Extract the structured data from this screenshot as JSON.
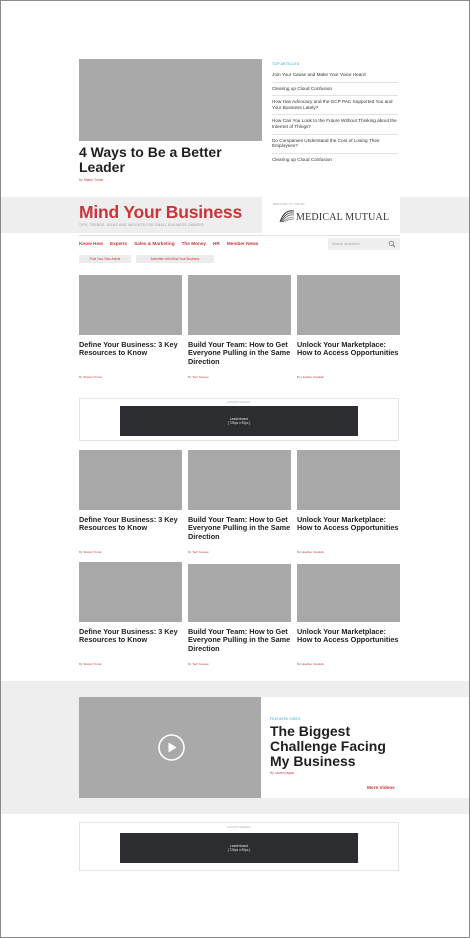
{
  "hero": {
    "title": "4 Ways to Be a Better Leader",
    "byline_prefix": "By",
    "author": "Shawn Turner"
  },
  "top_articles": {
    "label": "TOP ARTICLES",
    "items": [
      "Join Your Cause and Make Your Voice Heard",
      "Clearing up Cloud Confusion",
      "How Has Advocacy and the GCP PAC Supported You and Your Business Lately?",
      "How Can You Look to the Future Without Thinking about the Internet of Things?",
      "Do Companies Understand the Cost of Losing Their Employees?",
      "Clearing up Cloud Confusion"
    ]
  },
  "brand": {
    "title": "Mind Your Business",
    "tagline": "TIPS, TRENDS, IDEAS AND INSIGHTS FOR SMALL BUSINESS OWNERS",
    "sponsor_label": "BROUGHT TO YOU BY",
    "sponsor_name": "MEDICAL MUTUAL"
  },
  "nav": {
    "items": [
      "Know How",
      "Experts",
      "Sales & Marketing",
      "The Money",
      "HR",
      "Member News"
    ],
    "search_placeholder": "Search all articles",
    "pills": [
      "Post Your Own Article",
      "Advertise with Mind Your Business"
    ]
  },
  "cards": [
    {
      "title": "Define Your Business: 3 Key Resources to Know",
      "author": "Shawn Turner"
    },
    {
      "title": "Build Your Team: How to Get Everyone Pulling in the Same Direction",
      "author": "Terri Kessey"
    },
    {
      "title": "Unlock Your Marketplace: How to Access Opportunities",
      "author": "Heather Cardullo"
    }
  ],
  "ad": {
    "label": "ADVERTISEMENT",
    "line1": "Leaderboard",
    "line2": "[ 728px x 90px ]"
  },
  "featured_video": {
    "label": "FEATURED VIDEO",
    "title": "The Biggest Challenge Facing My Business",
    "author": "Lauren Iaquin",
    "more_label": "More Videos"
  },
  "icons": {
    "search": "search-icon",
    "play": "play-icon",
    "logo": "medical-mutual-logo-icon"
  },
  "colors": {
    "brand_red": "#c8363a",
    "accent_teal": "#2ba0c8",
    "placeholder_gray": "#a9a9a9",
    "band_gray": "#eeeeee",
    "ad_dark": "#2b2d30"
  }
}
